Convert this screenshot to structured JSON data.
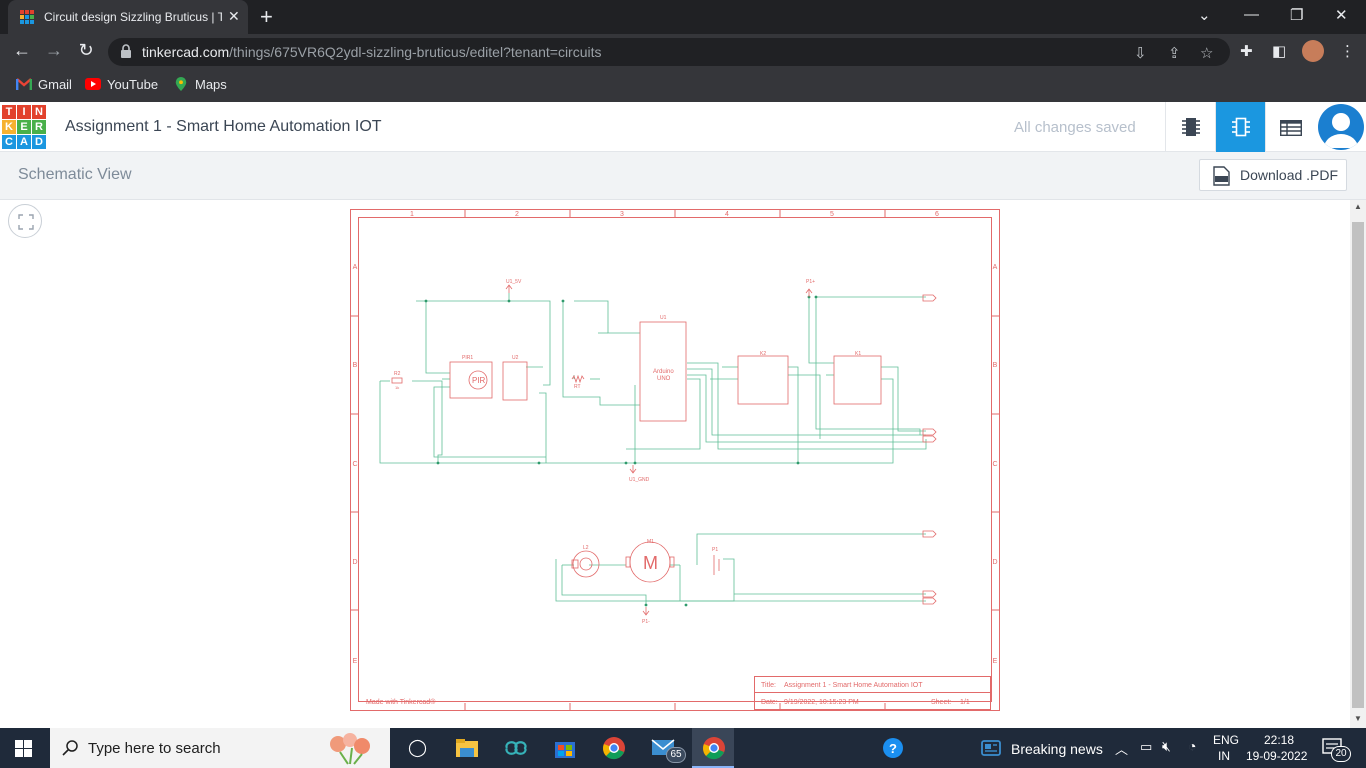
{
  "browser": {
    "tab_title": "Circuit design Sizzling Bruticus | T",
    "url_host": "tinkercad.com",
    "url_path": "/things/675VR6Q2ydl-sizzling-bruticus/editel?tenant=circuits",
    "bookmarks": [
      {
        "label": "Gmail",
        "icon": "gmail-icon"
      },
      {
        "label": "YouTube",
        "icon": "youtube-icon"
      },
      {
        "label": "Maps",
        "icon": "maps-icon"
      }
    ]
  },
  "app": {
    "logo_letters": [
      "T",
      "I",
      "N",
      "K",
      "E",
      "R",
      "C",
      "A",
      "D"
    ],
    "project_title": "Assignment 1 - Smart Home Automation IOT",
    "save_status": "All changes saved",
    "view_title": "Schematic View",
    "download_label": "Download .PDF",
    "accent_color": "#1b97e0"
  },
  "schematic": {
    "columns": [
      "1",
      "2",
      "3",
      "4",
      "5",
      "6"
    ],
    "rows": [
      "A",
      "B",
      "C",
      "D",
      "E"
    ],
    "labels": {
      "u1_5v": "U1_5V",
      "u1_gnd": "U1_GND",
      "p1_plus": "P1+",
      "p1_minus": "P1-",
      "r2": "R2",
      "r2_val": "1k",
      "pir_ref": "PIR1",
      "pir_body": "PIR",
      "u2_ref": "U2",
      "rt_ref": "RT",
      "u1_ref": "U1",
      "arduino": "Arduino",
      "uno": "UNO",
      "k2_ref": "K2",
      "k1_ref": "K1",
      "l2_ref": "L2",
      "m1_ref": "M1",
      "motor": "M",
      "p1_ref": "P1"
    },
    "title_block": {
      "title_label": "Title:",
      "title_value": "Assignment 1 - Smart Home Automation IOT",
      "date_label": "Date:",
      "date_value": "9/19/2022, 10:15:23 PM",
      "sheet_label": "Sheet:",
      "sheet_value": "1/1",
      "made_with": "Made with Tinkercad®"
    }
  },
  "taskbar": {
    "search_placeholder": "Type here to search",
    "mail_badge": "65",
    "news": "Breaking news",
    "lang_top": "ENG",
    "lang_bottom": "IN",
    "time": "22:18",
    "date": "19-09-2022",
    "notif_count": "20"
  }
}
